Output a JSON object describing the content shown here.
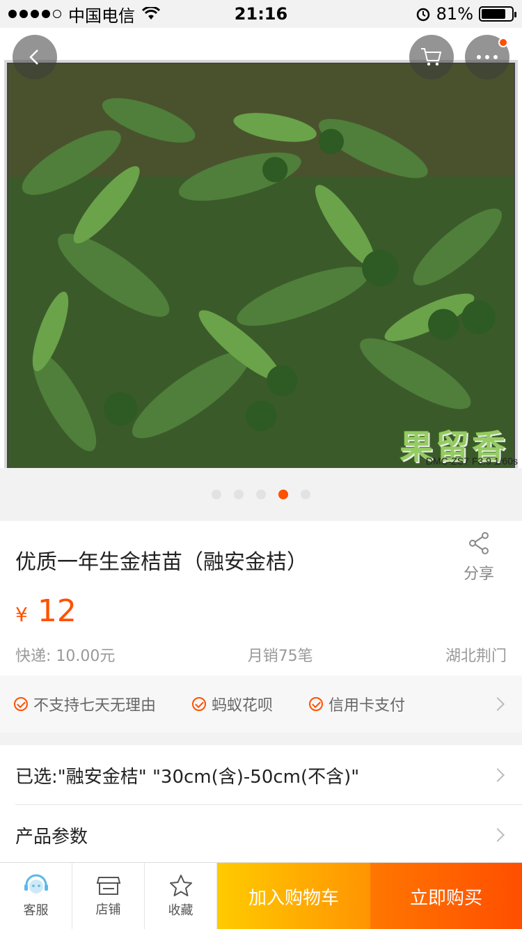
{
  "status_bar": {
    "carrier": "中国电信",
    "time": "21:16",
    "battery_percent": "81%",
    "battery_level": 0.81
  },
  "gallery": {
    "watermark": "果留香",
    "exif": "DMC-ZS7 F3.9 1/60s",
    "page_count": 5,
    "active_index": 3
  },
  "product": {
    "title": "优质一年生金桔苗（融安金桔）",
    "share_label": "分享",
    "currency": "¥",
    "price": "12",
    "shipping": "快递: 10.00元",
    "monthly_sales": "月销75笔",
    "location": "湖北荆门"
  },
  "services": [
    "不支持七天无理由",
    "蚂蚁花呗",
    "信用卡支付"
  ],
  "selection": {
    "selected_text": "已选:\"融安金桔\" \"30cm(含)-50cm(不含)\"",
    "params_label": "产品参数"
  },
  "bottom_bar": {
    "service_label": "客服",
    "shop_label": "店铺",
    "favorite_label": "收藏",
    "add_to_cart": "加入购物车",
    "buy_now": "立即购买"
  },
  "colors": {
    "accent": "#ff5000",
    "cart_button": "#ffa800",
    "buy_button": "#ff5f00"
  },
  "icons": [
    "back-icon",
    "cart-icon",
    "more-icon",
    "share-icon",
    "check-icon",
    "chevron-right-icon",
    "customer-service-icon",
    "shop-icon",
    "star-icon"
  ]
}
